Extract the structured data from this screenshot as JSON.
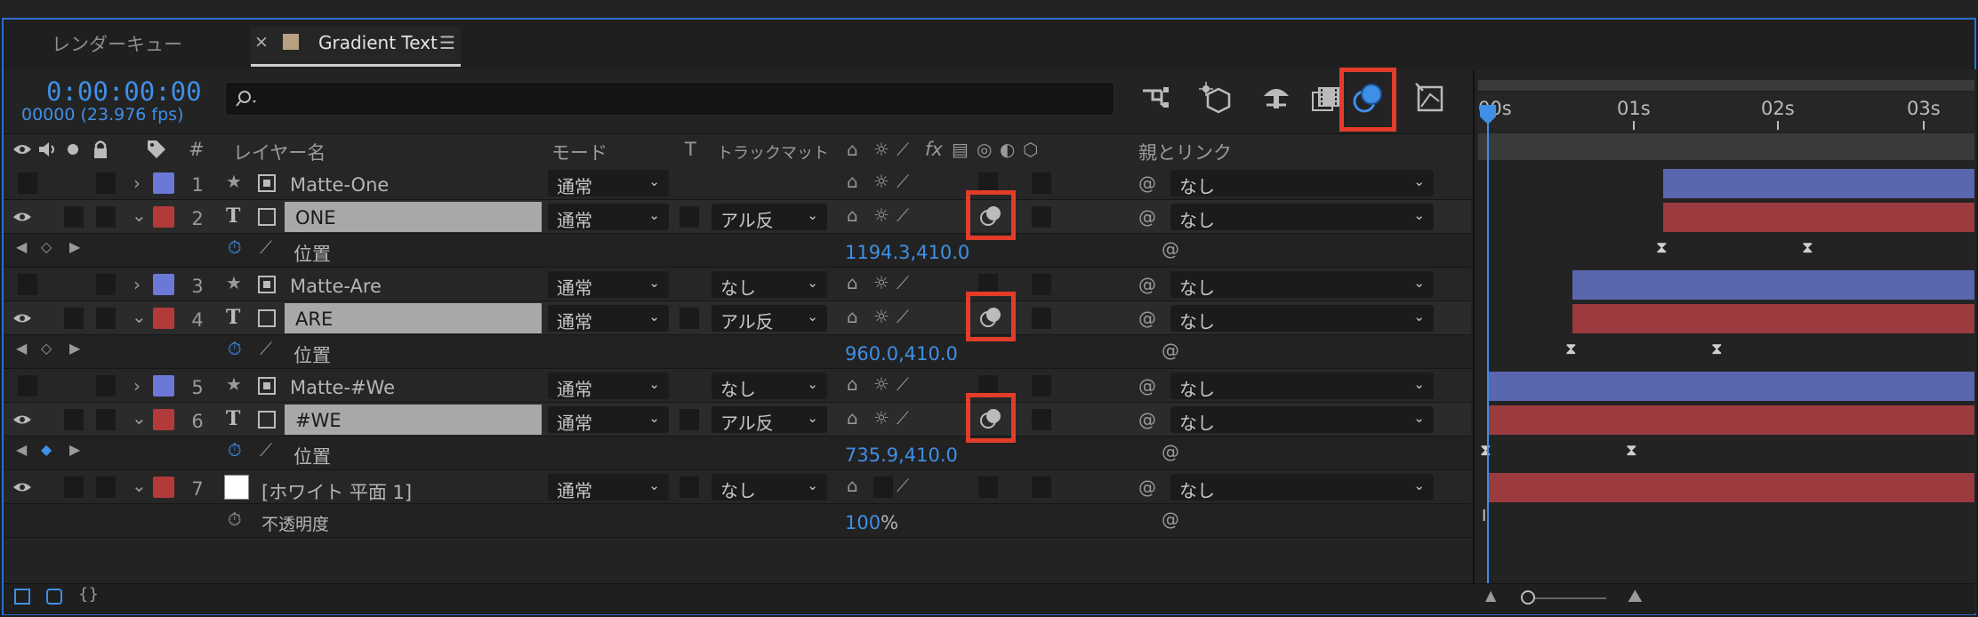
{
  "tabs": {
    "render_queue": "レンダーキュー",
    "comp_close": "×",
    "comp": "Gradient Text",
    "menu": "☰"
  },
  "time": {
    "current": "0:00:00:00",
    "frames_fps": "00000 (23.976 fps)"
  },
  "search": {
    "placeholder": "",
    "icon": "search-icon"
  },
  "headers": {
    "num": "#",
    "layer_name": "レイヤー名",
    "mode": "モード",
    "t": "T",
    "trackmatte": "トラックマット",
    "fx": "fx",
    "parent": "親とリンク"
  },
  "ruler": {
    "t0": "00s",
    "t1": "01s",
    "t2": "02s",
    "t3": "03s"
  },
  "layers": [
    {
      "num": "1",
      "name": "Matte-One",
      "mode": "通常",
      "parent": "なし",
      "color": "#6b78d8"
    },
    {
      "num": "2",
      "name": "ONE",
      "mode": "通常",
      "matte": "アル反",
      "parent": "なし",
      "color": "#b23a3a"
    },
    {
      "num": "3",
      "name": "Matte-Are",
      "mode": "通常",
      "matte": "なし",
      "parent": "なし",
      "color": "#6b78d8"
    },
    {
      "num": "4",
      "name": "ARE",
      "mode": "通常",
      "matte": "アル反",
      "parent": "なし",
      "color": "#b23a3a"
    },
    {
      "num": "5",
      "name": "Matte-#We",
      "mode": "通常",
      "matte": "なし",
      "parent": "なし",
      "color": "#6b78d8"
    },
    {
      "num": "6",
      "name": "#WE",
      "mode": "通常",
      "matte": "アル反",
      "parent": "なし",
      "color": "#b23a3a"
    },
    {
      "num": "7",
      "name": "[ホワイト 平面 1]",
      "mode": "通常",
      "matte": "なし",
      "parent": "なし",
      "color": "#b23a3a"
    }
  ],
  "props": {
    "position_label": "位置",
    "opacity_label": "不透明度",
    "pos2": "1194.3,410.0",
    "pos4": "960.0,410.0",
    "pos6": "735.9,410.0",
    "opacity": "100",
    "opacity_unit": "%"
  },
  "colors": {
    "accent": "#3f8fe6",
    "highlight": "#e23d2a"
  }
}
